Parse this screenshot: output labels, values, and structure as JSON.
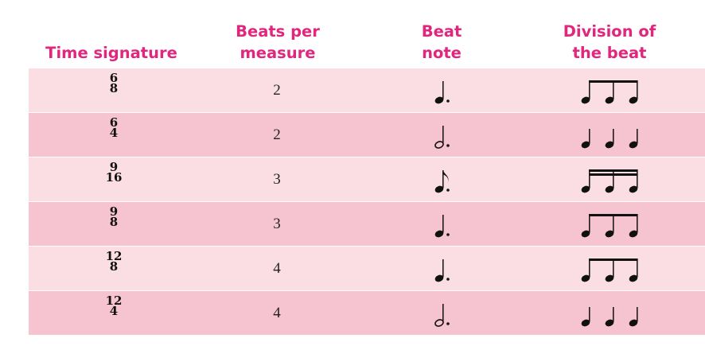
{
  "headers": {
    "time_signature": "Time signature",
    "beats_per_measure": "Beats per\nmeasure",
    "beat_note": "Beat\nnote",
    "division": "Division of\nthe beat"
  },
  "rows": [
    {
      "top": "6",
      "bottom": "8",
      "beats": "2",
      "beat_note": "dotted-quarter-note-icon",
      "division": "three-eighth-notes-beamed-icon"
    },
    {
      "top": "6",
      "bottom": "4",
      "beats": "2",
      "beat_note": "dotted-half-note-icon",
      "division": "three-quarter-notes-icon"
    },
    {
      "top": "9",
      "bottom": "16",
      "beats": "3",
      "beat_note": "dotted-eighth-note-icon",
      "division": "three-sixteenth-notes-beamed-icon"
    },
    {
      "top": "9",
      "bottom": "8",
      "beats": "3",
      "beat_note": "dotted-quarter-note-icon",
      "division": "three-eighth-notes-beamed-icon"
    },
    {
      "top": "12",
      "bottom": "8",
      "beats": "4",
      "beat_note": "dotted-quarter-note-icon",
      "division": "three-eighth-notes-beamed-icon"
    },
    {
      "top": "12",
      "bottom": "4",
      "beats": "4",
      "beat_note": "dotted-half-note-icon",
      "division": "three-quarter-notes-icon"
    }
  ],
  "colors": {
    "header_text": "#e0267d",
    "row_light": "#fbdde4",
    "row_dark": "#f6c3d0"
  }
}
